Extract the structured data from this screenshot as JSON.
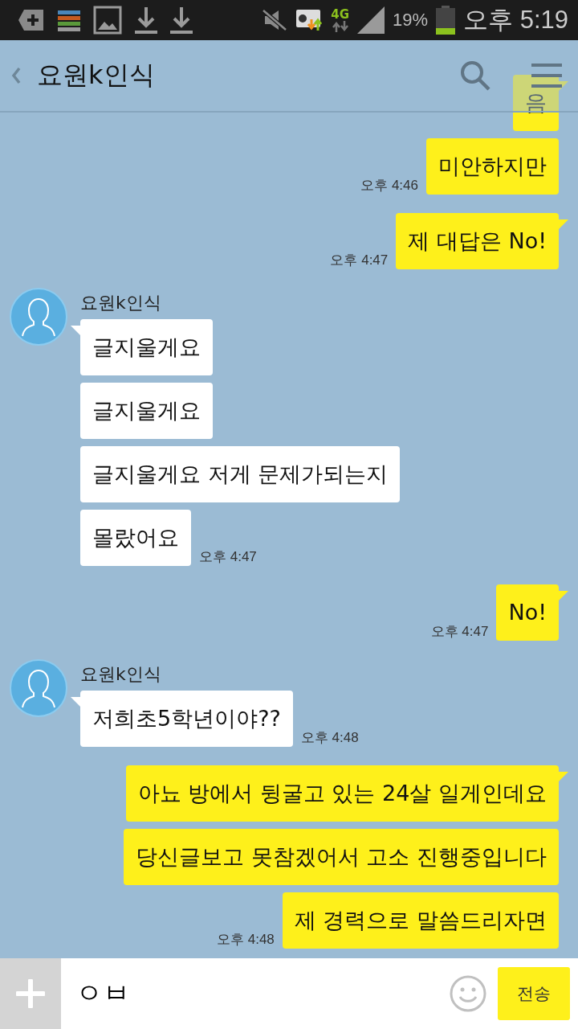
{
  "status_bar": {
    "network": "4G",
    "battery": "19%",
    "time": "오후 5:19"
  },
  "header": {
    "title": "요원k인식"
  },
  "messages": [
    {
      "kind": "outgoing",
      "bubbles": [
        "음",
        "미안하지만"
      ],
      "time": "오후 4:46"
    },
    {
      "kind": "outgoing",
      "bubbles": [
        "제 대답은 No!"
      ],
      "time": "오후 4:47"
    },
    {
      "kind": "incoming",
      "sender": "요원k인식",
      "bubbles": [
        "글지울게요",
        "글지울게요",
        "글지울게요 저게 문제가되는지",
        "몰랐어요"
      ],
      "time": "오후 4:47"
    },
    {
      "kind": "outgoing",
      "bubbles": [
        "No!"
      ],
      "time": "오후 4:47"
    },
    {
      "kind": "incoming",
      "sender": "요원k인식",
      "bubbles": [
        "저희초5학년이야??"
      ],
      "time": "오후 4:48"
    },
    {
      "kind": "outgoing",
      "bubbles": [
        "아뇨 방에서 뒹굴고 있는 24살 일게인데요",
        "당신글보고 못참겠어서 고소 진행중입니다",
        "제 경력으로 말씀드리자면"
      ],
      "time": "오후 4:48"
    }
  ],
  "input": {
    "value": "ㅇㅂ",
    "send": "전송"
  }
}
